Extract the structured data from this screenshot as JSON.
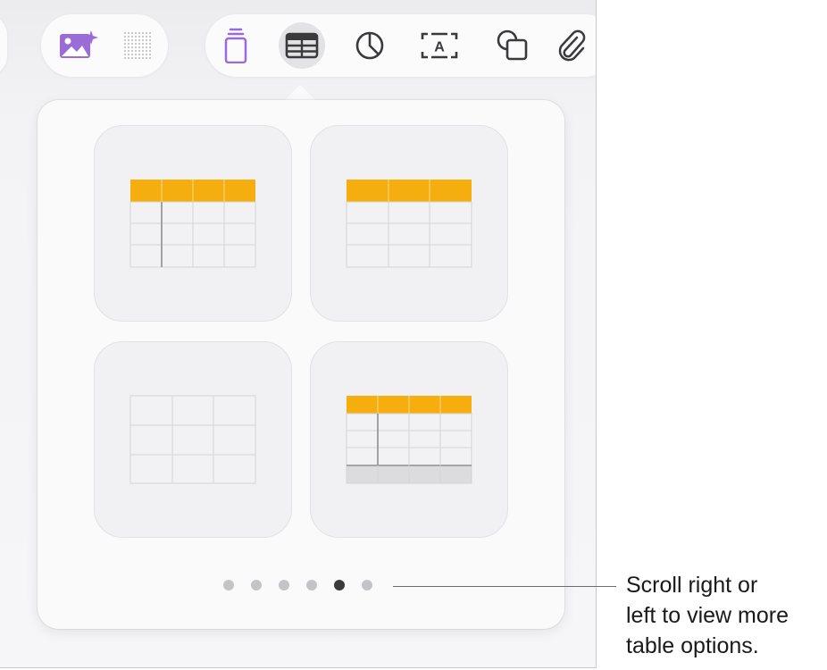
{
  "toolbar": {
    "media_buttons": [
      {
        "name": "photo-sparkle-icon",
        "color": "#9b6bd8"
      },
      {
        "name": "dot-grid-icon",
        "color": "#b9b9bd"
      }
    ],
    "insert_buttons": [
      {
        "name": "shape-stack-icon",
        "color": "#9b6bd8"
      },
      {
        "name": "table-icon",
        "selected": true
      },
      {
        "name": "chart-icon"
      },
      {
        "name": "text-box-icon",
        "label": "A"
      },
      {
        "name": "shapes-icon"
      },
      {
        "name": "attachment-icon"
      }
    ]
  },
  "popover": {
    "table_styles": [
      {
        "name": "header-row-and-column",
        "header_color": "#f6ae0e"
      },
      {
        "name": "header-row",
        "header_color": "#f6ae0e"
      },
      {
        "name": "plain"
      },
      {
        "name": "header-row-column-and-footer",
        "header_color": "#f6ae0e"
      }
    ],
    "page_count": 6,
    "current_page": 5
  },
  "callout": {
    "text": "Scroll right or\nleft to view more\ntable options."
  }
}
